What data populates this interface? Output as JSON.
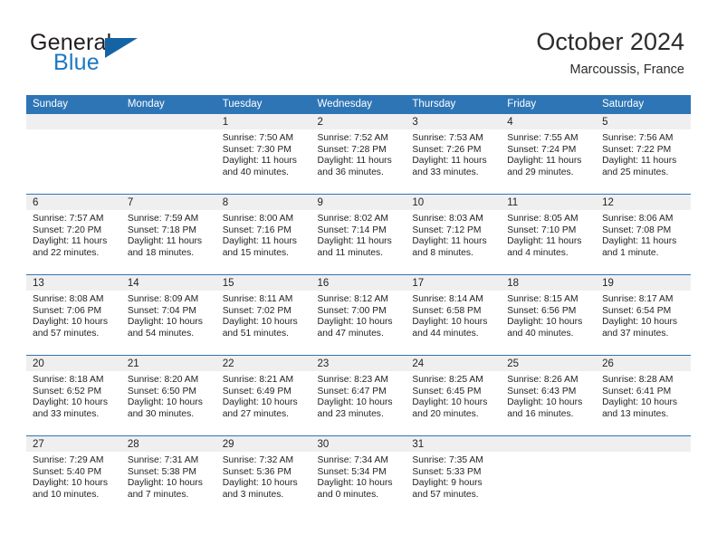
{
  "brand": {
    "word1": "General",
    "word2": "Blue",
    "flag_icon": "triangle-flag-icon",
    "blue_hex": "#1d78c1",
    "flag_hex": "#1464a5"
  },
  "header": {
    "title": "October 2024",
    "subtitle": "Marcoussis, France"
  },
  "theme": {
    "header_blue": "#2e75b6",
    "daynum_band": "#efefef",
    "text": "#231f20"
  },
  "weekdays": [
    "Sunday",
    "Monday",
    "Tuesday",
    "Wednesday",
    "Thursday",
    "Friday",
    "Saturday"
  ],
  "weeks": [
    [
      {
        "day": "",
        "lines": []
      },
      {
        "day": "",
        "lines": []
      },
      {
        "day": "1",
        "lines": [
          "Sunrise: 7:50 AM",
          "Sunset: 7:30 PM",
          "Daylight: 11 hours",
          "and 40 minutes."
        ]
      },
      {
        "day": "2",
        "lines": [
          "Sunrise: 7:52 AM",
          "Sunset: 7:28 PM",
          "Daylight: 11 hours",
          "and 36 minutes."
        ]
      },
      {
        "day": "3",
        "lines": [
          "Sunrise: 7:53 AM",
          "Sunset: 7:26 PM",
          "Daylight: 11 hours",
          "and 33 minutes."
        ]
      },
      {
        "day": "4",
        "lines": [
          "Sunrise: 7:55 AM",
          "Sunset: 7:24 PM",
          "Daylight: 11 hours",
          "and 29 minutes."
        ]
      },
      {
        "day": "5",
        "lines": [
          "Sunrise: 7:56 AM",
          "Sunset: 7:22 PM",
          "Daylight: 11 hours",
          "and 25 minutes."
        ]
      }
    ],
    [
      {
        "day": "6",
        "lines": [
          "Sunrise: 7:57 AM",
          "Sunset: 7:20 PM",
          "Daylight: 11 hours",
          "and 22 minutes."
        ]
      },
      {
        "day": "7",
        "lines": [
          "Sunrise: 7:59 AM",
          "Sunset: 7:18 PM",
          "Daylight: 11 hours",
          "and 18 minutes."
        ]
      },
      {
        "day": "8",
        "lines": [
          "Sunrise: 8:00 AM",
          "Sunset: 7:16 PM",
          "Daylight: 11 hours",
          "and 15 minutes."
        ]
      },
      {
        "day": "9",
        "lines": [
          "Sunrise: 8:02 AM",
          "Sunset: 7:14 PM",
          "Daylight: 11 hours",
          "and 11 minutes."
        ]
      },
      {
        "day": "10",
        "lines": [
          "Sunrise: 8:03 AM",
          "Sunset: 7:12 PM",
          "Daylight: 11 hours",
          "and 8 minutes."
        ]
      },
      {
        "day": "11",
        "lines": [
          "Sunrise: 8:05 AM",
          "Sunset: 7:10 PM",
          "Daylight: 11 hours",
          "and 4 minutes."
        ]
      },
      {
        "day": "12",
        "lines": [
          "Sunrise: 8:06 AM",
          "Sunset: 7:08 PM",
          "Daylight: 11 hours",
          "and 1 minute."
        ]
      }
    ],
    [
      {
        "day": "13",
        "lines": [
          "Sunrise: 8:08 AM",
          "Sunset: 7:06 PM",
          "Daylight: 10 hours",
          "and 57 minutes."
        ]
      },
      {
        "day": "14",
        "lines": [
          "Sunrise: 8:09 AM",
          "Sunset: 7:04 PM",
          "Daylight: 10 hours",
          "and 54 minutes."
        ]
      },
      {
        "day": "15",
        "lines": [
          "Sunrise: 8:11 AM",
          "Sunset: 7:02 PM",
          "Daylight: 10 hours",
          "and 51 minutes."
        ]
      },
      {
        "day": "16",
        "lines": [
          "Sunrise: 8:12 AM",
          "Sunset: 7:00 PM",
          "Daylight: 10 hours",
          "and 47 minutes."
        ]
      },
      {
        "day": "17",
        "lines": [
          "Sunrise: 8:14 AM",
          "Sunset: 6:58 PM",
          "Daylight: 10 hours",
          "and 44 minutes."
        ]
      },
      {
        "day": "18",
        "lines": [
          "Sunrise: 8:15 AM",
          "Sunset: 6:56 PM",
          "Daylight: 10 hours",
          "and 40 minutes."
        ]
      },
      {
        "day": "19",
        "lines": [
          "Sunrise: 8:17 AM",
          "Sunset: 6:54 PM",
          "Daylight: 10 hours",
          "and 37 minutes."
        ]
      }
    ],
    [
      {
        "day": "20",
        "lines": [
          "Sunrise: 8:18 AM",
          "Sunset: 6:52 PM",
          "Daylight: 10 hours",
          "and 33 minutes."
        ]
      },
      {
        "day": "21",
        "lines": [
          "Sunrise: 8:20 AM",
          "Sunset: 6:50 PM",
          "Daylight: 10 hours",
          "and 30 minutes."
        ]
      },
      {
        "day": "22",
        "lines": [
          "Sunrise: 8:21 AM",
          "Sunset: 6:49 PM",
          "Daylight: 10 hours",
          "and 27 minutes."
        ]
      },
      {
        "day": "23",
        "lines": [
          "Sunrise: 8:23 AM",
          "Sunset: 6:47 PM",
          "Daylight: 10 hours",
          "and 23 minutes."
        ]
      },
      {
        "day": "24",
        "lines": [
          "Sunrise: 8:25 AM",
          "Sunset: 6:45 PM",
          "Daylight: 10 hours",
          "and 20 minutes."
        ]
      },
      {
        "day": "25",
        "lines": [
          "Sunrise: 8:26 AM",
          "Sunset: 6:43 PM",
          "Daylight: 10 hours",
          "and 16 minutes."
        ]
      },
      {
        "day": "26",
        "lines": [
          "Sunrise: 8:28 AM",
          "Sunset: 6:41 PM",
          "Daylight: 10 hours",
          "and 13 minutes."
        ]
      }
    ],
    [
      {
        "day": "27",
        "lines": [
          "Sunrise: 7:29 AM",
          "Sunset: 5:40 PM",
          "Daylight: 10 hours",
          "and 10 minutes."
        ]
      },
      {
        "day": "28",
        "lines": [
          "Sunrise: 7:31 AM",
          "Sunset: 5:38 PM",
          "Daylight: 10 hours",
          "and 7 minutes."
        ]
      },
      {
        "day": "29",
        "lines": [
          "Sunrise: 7:32 AM",
          "Sunset: 5:36 PM",
          "Daylight: 10 hours",
          "and 3 minutes."
        ]
      },
      {
        "day": "30",
        "lines": [
          "Sunrise: 7:34 AM",
          "Sunset: 5:34 PM",
          "Daylight: 10 hours",
          "and 0 minutes."
        ]
      },
      {
        "day": "31",
        "lines": [
          "Sunrise: 7:35 AM",
          "Sunset: 5:33 PM",
          "Daylight: 9 hours",
          "and 57 minutes."
        ]
      },
      {
        "day": "",
        "lines": []
      },
      {
        "day": "",
        "lines": []
      }
    ]
  ]
}
